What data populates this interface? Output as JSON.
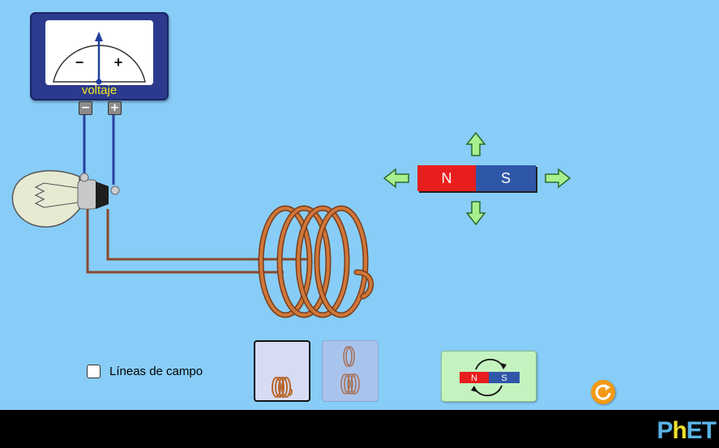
{
  "voltmeter": {
    "label": "voltaje",
    "scale_minus": "−",
    "scale_plus": "+",
    "terminal_minus": "−",
    "terminal_plus": "+"
  },
  "magnet": {
    "north_label": "N",
    "south_label": "S",
    "north_color": "#e81d1d",
    "south_color": "#2f57a8"
  },
  "controls": {
    "field_lines_label": "Líneas de campo",
    "field_lines_checked": false,
    "coil_options": [
      "one-loop-coil",
      "two-coils"
    ],
    "selected_coil": "one-loop-coil",
    "flip_magnet_north": "N",
    "flip_magnet_south": "S"
  },
  "branding": {
    "logo_p": "P",
    "logo_h": "h",
    "logo_et": "ET"
  },
  "colors": {
    "background": "#87CDF7",
    "wire": "#8b4a2b",
    "coil": "#c46a2e",
    "arrow_fill": "#a8f08e",
    "reset": "#f39a13"
  },
  "icons": {
    "move_up": "arrow-up-icon",
    "move_down": "arrow-down-icon",
    "move_left": "arrow-left-icon",
    "move_right": "arrow-right-icon",
    "reset": "reset-icon",
    "flip": "flip-icon"
  }
}
